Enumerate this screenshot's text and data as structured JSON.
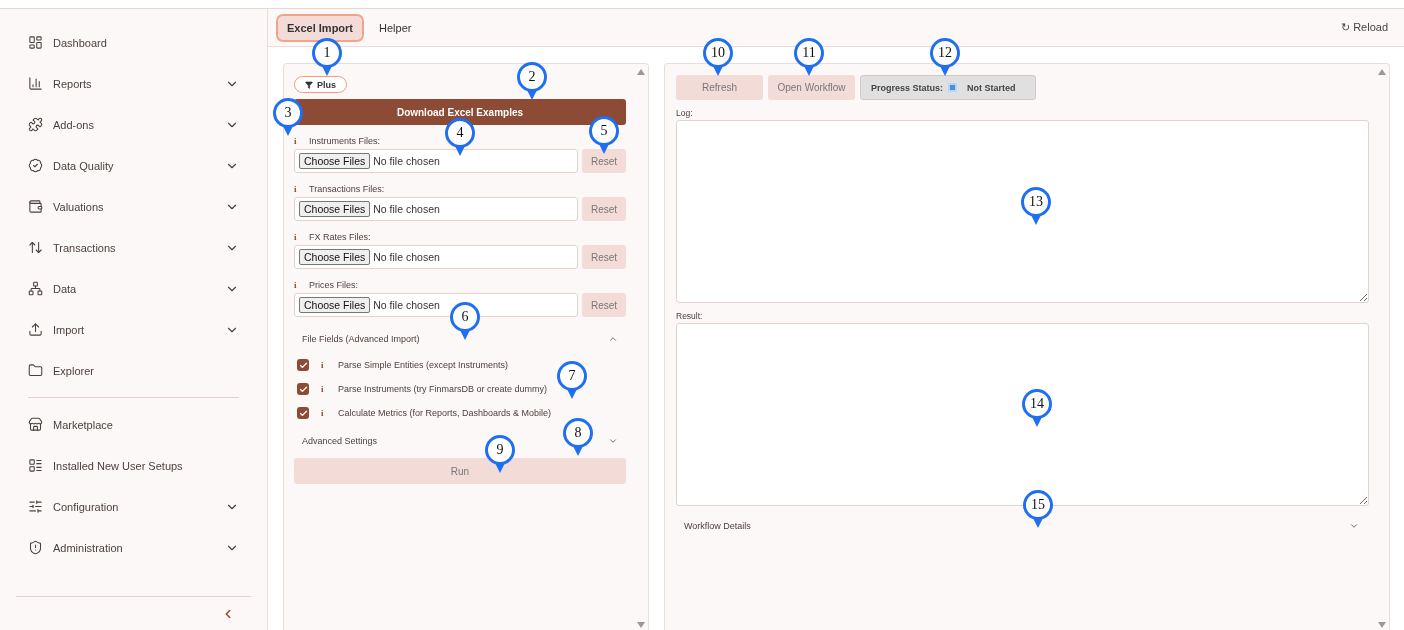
{
  "sidebar": {
    "sections": [
      {
        "items": [
          {
            "label": "Dashboard",
            "expandable": false
          },
          {
            "label": "Reports",
            "expandable": true
          },
          {
            "label": "Add-ons",
            "expandable": true
          },
          {
            "label": "Data Quality",
            "expandable": true
          },
          {
            "label": "Valuations",
            "expandable": true
          },
          {
            "label": "Transactions",
            "expandable": true
          },
          {
            "label": "Data",
            "expandable": true
          },
          {
            "label": "Import",
            "expandable": true
          },
          {
            "label": "Explorer",
            "expandable": false
          }
        ]
      },
      {
        "items": [
          {
            "label": "Marketplace",
            "expandable": false
          },
          {
            "label": "Installed New User Setups",
            "expandable": false
          },
          {
            "label": "Configuration",
            "expandable": true
          },
          {
            "label": "Administration",
            "expandable": true
          }
        ]
      }
    ]
  },
  "tabs": [
    {
      "label": "Excel Import",
      "selected": true
    },
    {
      "label": "Helper",
      "selected": false
    }
  ],
  "reload": {
    "label": "↻ Reload"
  },
  "import_panel": {
    "plus_button": "Plus",
    "download_button": "Download Excel Examples",
    "file_inputs": [
      {
        "info": "i",
        "label": "Instruments Files:",
        "choose": "Choose Files",
        "value": "No file chosen",
        "reset": "Reset"
      },
      {
        "info": "i",
        "label": "Transactions Files:",
        "choose": "Choose Files",
        "value": "No file chosen",
        "reset": "Reset"
      },
      {
        "info": "i",
        "label": "FX Rates Files:",
        "choose": "Choose Files",
        "value": "No file chosen",
        "reset": "Reset"
      },
      {
        "info": "i",
        "label": "Prices Files:",
        "choose": "Choose Files",
        "value": "No file chosen",
        "reset": "Reset"
      }
    ],
    "file_fields": {
      "title": "File Fields (Advanced Import)",
      "expanded": true,
      "options": [
        {
          "info": "i",
          "label": "Parse Simple Entities (except Instruments)",
          "checked": true
        },
        {
          "info": "i",
          "label": "Parse Instruments (try FinmarsDB or create dummy)",
          "checked": true
        },
        {
          "info": "i",
          "label": "Calculate Metrics (for Reports, Dashboards & Mobile)",
          "checked": true
        }
      ]
    },
    "advanced_settings": {
      "title": "Advanced Settings",
      "expanded": false
    },
    "run_button": "Run"
  },
  "workflow_panel": {
    "buttons": [
      "Refresh",
      "Open Workflow"
    ],
    "progress_status": {
      "label": "Progress Status:",
      "value": "Not Started"
    },
    "log": {
      "label": "Log:"
    },
    "result": {
      "label": "Result:"
    },
    "workflow_details": {
      "title": "Workflow Details",
      "expanded": false
    }
  },
  "callouts": [
    "1",
    "2",
    "3",
    "4",
    "5",
    "6",
    "7",
    "8",
    "9",
    "10",
    "11",
    "12",
    "13",
    "14",
    "15"
  ]
}
